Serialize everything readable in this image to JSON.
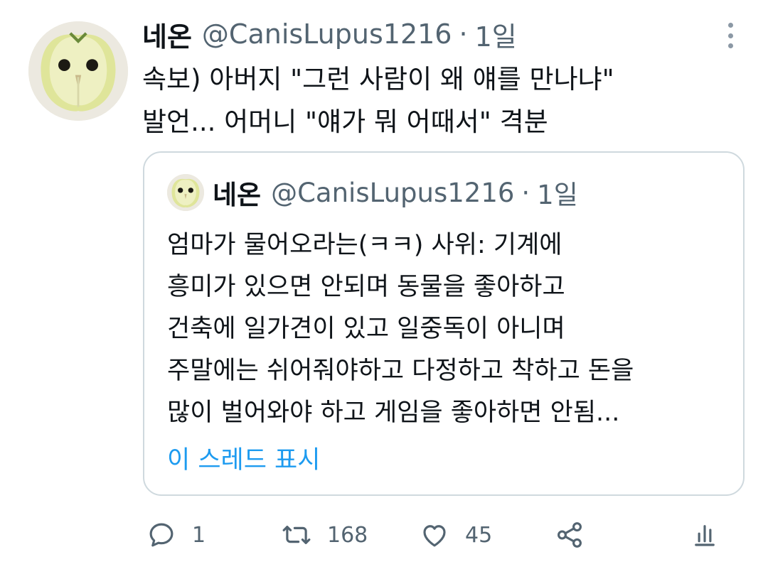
{
  "tweet": {
    "author_name": "네온",
    "handle": "@CanisLupus1216",
    "separator": "·",
    "time": "1일",
    "text": "속보) 아버지 \"그런 사람이 왜 얘를 만나냐\"\n발언... 어머니 \"얘가 뭐 어때서\" 격분",
    "avatar_icon": "owl-apple-avatar",
    "more_icon": "more-vertical-icon"
  },
  "quote": {
    "author_name": "네온",
    "handle": "@CanisLupus1216",
    "separator": "·",
    "time": "1일",
    "text": "엄마가 물어오라는(ㅋㅋ) 사위: 기계에\n흥미가 있으면 안되며 동물을 좋아하고\n건축에 일가견이 있고 일중독이 아니며\n주말에는 쉬어줘야하고 다정하고 착하고 돈을\n많이 벌어와야 하고 게임을 좋아하면 안됨...",
    "show_thread": "이 스레드 표시"
  },
  "actions": {
    "reply_icon": "reply-icon",
    "reply_count": "1",
    "retweet_icon": "retweet-icon",
    "retweet_count": "168",
    "like_icon": "heart-icon",
    "like_count": "45",
    "share_icon": "share-icon",
    "analytics_icon": "analytics-icon"
  },
  "colors": {
    "text": "#0f1419",
    "secondary": "#536471",
    "link": "#1d9bf0",
    "border": "#cfd9de"
  }
}
